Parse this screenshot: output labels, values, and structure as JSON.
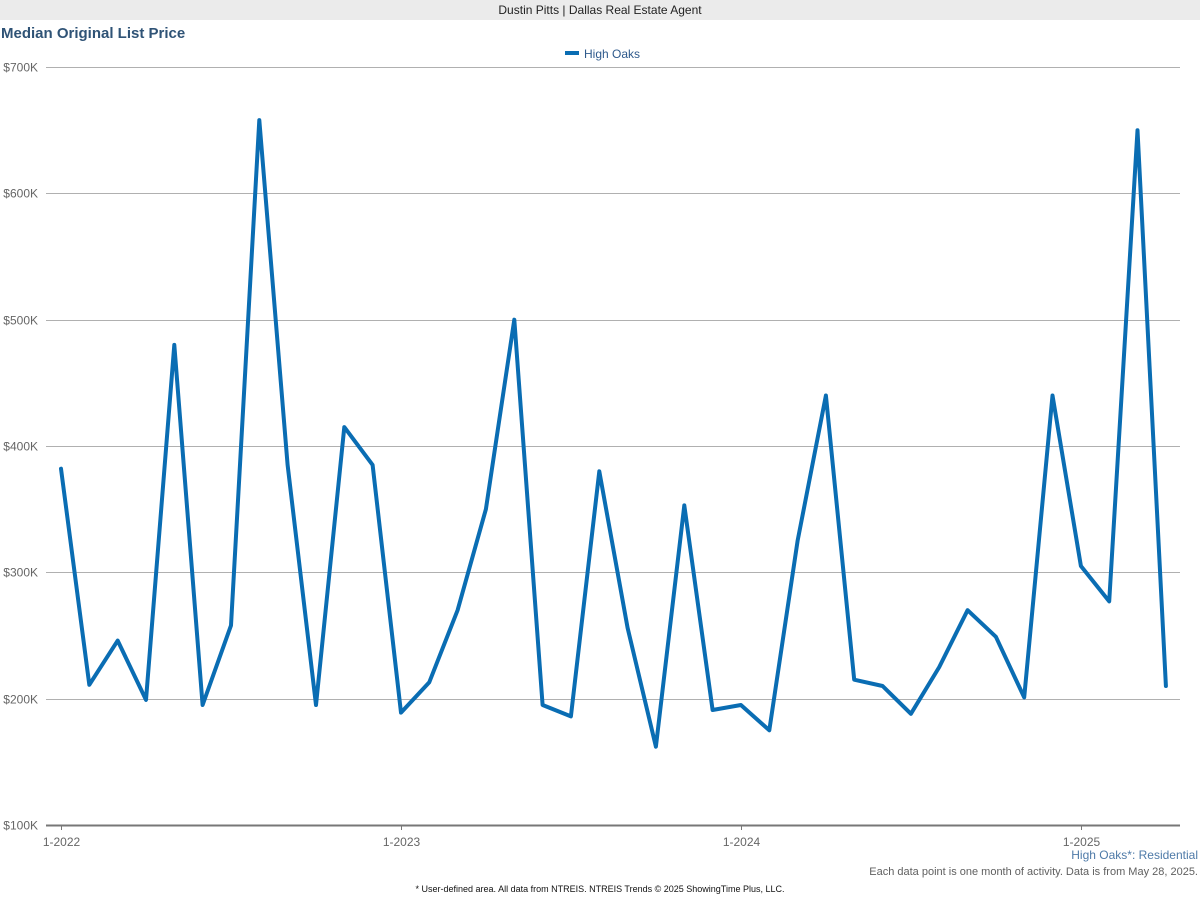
{
  "header": {
    "banner": "Dustin Pitts | Dallas Real Estate Agent"
  },
  "chart_data": {
    "type": "line",
    "title": "Median Original List Price",
    "x": [
      "1-2022",
      "2-2022",
      "3-2022",
      "4-2022",
      "5-2022",
      "6-2022",
      "7-2022",
      "8-2022",
      "9-2022",
      "10-2022",
      "11-2022",
      "12-2022",
      "1-2023",
      "2-2023",
      "3-2023",
      "4-2023",
      "5-2023",
      "6-2023",
      "7-2023",
      "8-2023",
      "9-2023",
      "10-2023",
      "11-2023",
      "12-2023",
      "1-2024",
      "2-2024",
      "3-2024",
      "4-2024",
      "5-2024",
      "6-2024",
      "7-2024",
      "8-2024",
      "9-2024",
      "10-2024",
      "11-2024",
      "12-2024",
      "1-2025",
      "2-2025",
      "3-2025",
      "4-2025"
    ],
    "series": [
      {
        "name": "High Oaks",
        "color": "#0a6db3",
        "values": [
          382000,
          211000,
          246000,
          199000,
          480000,
          195000,
          258000,
          658000,
          385000,
          195000,
          415000,
          385000,
          189000,
          213000,
          270000,
          350000,
          500000,
          195000,
          186000,
          380000,
          256000,
          162000,
          353000,
          191000,
          195000,
          175000,
          325000,
          440000,
          215000,
          210000,
          188000,
          225000,
          270000,
          249000,
          201000,
          440000,
          305000,
          277000,
          650000,
          210000
        ]
      }
    ],
    "x_tick_labels": [
      "1-2022",
      "1-2023",
      "1-2024",
      "1-2025"
    ],
    "y_tick_labels": [
      "$100K",
      "$200K",
      "$300K",
      "$400K",
      "$500K",
      "$600K",
      "$700K"
    ],
    "y_ticks": [
      100000,
      200000,
      300000,
      400000,
      500000,
      600000,
      700000
    ],
    "ylim": [
      100000,
      700000
    ],
    "grid": true,
    "legend_position": "top-center",
    "grid_color": "#b0b0b0",
    "axis_color": "#777777"
  },
  "footer": {
    "series_caption": "High Oaks*: Residential",
    "data_note": "Each data point is one month of activity. Data is from May 28, 2025.",
    "source_note": "* User-defined area. All data from NTREIS. NTREIS Trends © 2025 ShowingTime Plus, LLC."
  }
}
